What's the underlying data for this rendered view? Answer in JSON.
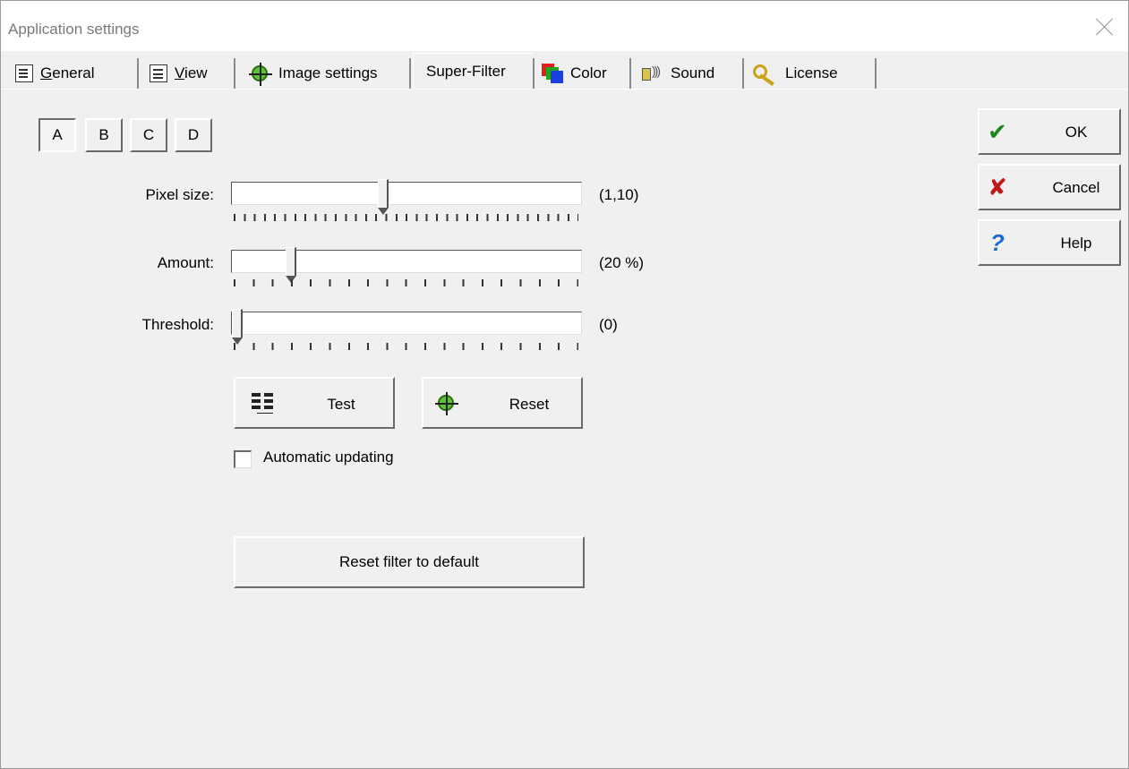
{
  "window": {
    "title": "Application settings"
  },
  "tabs": [
    {
      "prefix": "",
      "mnemonic": "G",
      "rest": "eneral",
      "icon": "general-icon"
    },
    {
      "prefix": "",
      "mnemonic": "V",
      "rest": "iew",
      "icon": "view-icon"
    },
    {
      "label": "Image settings",
      "icon": "bug-icon"
    },
    {
      "label": "Super-Filter",
      "active": true
    },
    {
      "label": "Color",
      "icon": "color-icon"
    },
    {
      "label": "Sound",
      "icon": "speaker-icon"
    },
    {
      "label": "License",
      "icon": "key-icon"
    }
  ],
  "presets": [
    "A",
    "B",
    "C",
    "D"
  ],
  "selected_preset": "A",
  "side_buttons": {
    "ok": "OK",
    "cancel": "Cancel",
    "help": "Help"
  },
  "sliders": [
    {
      "label": "Pixel size:",
      "value_text": "(1,10)",
      "position": 0.43
    },
    {
      "label": "Amount:",
      "value_text": "(20 %)",
      "position": 0.16
    },
    {
      "label": "Threshold:",
      "value_text": "(0)",
      "position": 0.0
    }
  ],
  "buttons": {
    "test": "Test",
    "reset": "Reset",
    "reset_default": "Reset filter to default"
  },
  "auto_update": {
    "label": "Automatic updating",
    "checked": false
  }
}
